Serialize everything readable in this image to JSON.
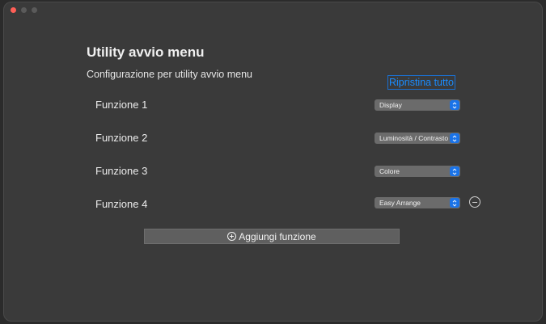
{
  "window": {
    "title": "Utility avvio menu",
    "subtitle": "Configurazione per utility avvio menu"
  },
  "actions": {
    "reset_label": "Ripristina tutto",
    "add_label": "Aggiungi funzione"
  },
  "functions": [
    {
      "label": "Funzione 1",
      "value": "Display"
    },
    {
      "label": "Funzione 2",
      "value": "Luminosità / Contrasto"
    },
    {
      "label": "Funzione 3",
      "value": "Colore"
    },
    {
      "label": "Funzione 4",
      "value": "Easy Arrange"
    }
  ],
  "icons": {
    "chevron": "updown-chevron-icon",
    "remove": "minus-circle-icon",
    "add": "plus-circle-icon"
  },
  "colors": {
    "accent": "#1a73e8",
    "link": "#1a8cff",
    "close": "#ff5f57"
  }
}
